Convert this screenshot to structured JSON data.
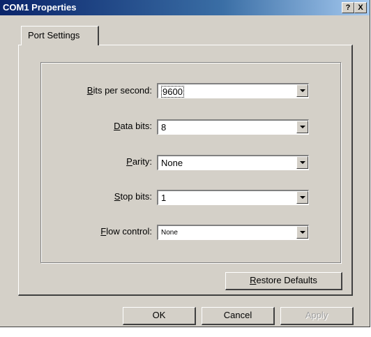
{
  "window": {
    "title": "COM1 Properties",
    "help_label": "?",
    "close_label": "X"
  },
  "tabs": [
    {
      "label": "Port Settings"
    }
  ],
  "settings": [
    {
      "prefix": "",
      "accel": "B",
      "rest": "its per second:",
      "value": "9600"
    },
    {
      "prefix": "",
      "accel": "D",
      "rest": "ata bits:",
      "value": "8"
    },
    {
      "prefix": "",
      "accel": "P",
      "rest": "arity:",
      "value": "None"
    },
    {
      "prefix": "",
      "accel": "S",
      "rest": "top bits:",
      "value": "1"
    },
    {
      "prefix": "",
      "accel": "F",
      "rest": "low control:",
      "value": "None"
    }
  ],
  "restore": {
    "accel": "R",
    "rest": "estore Defaults"
  },
  "buttons": {
    "ok": "OK",
    "cancel": "Cancel",
    "apply": "Apply"
  }
}
